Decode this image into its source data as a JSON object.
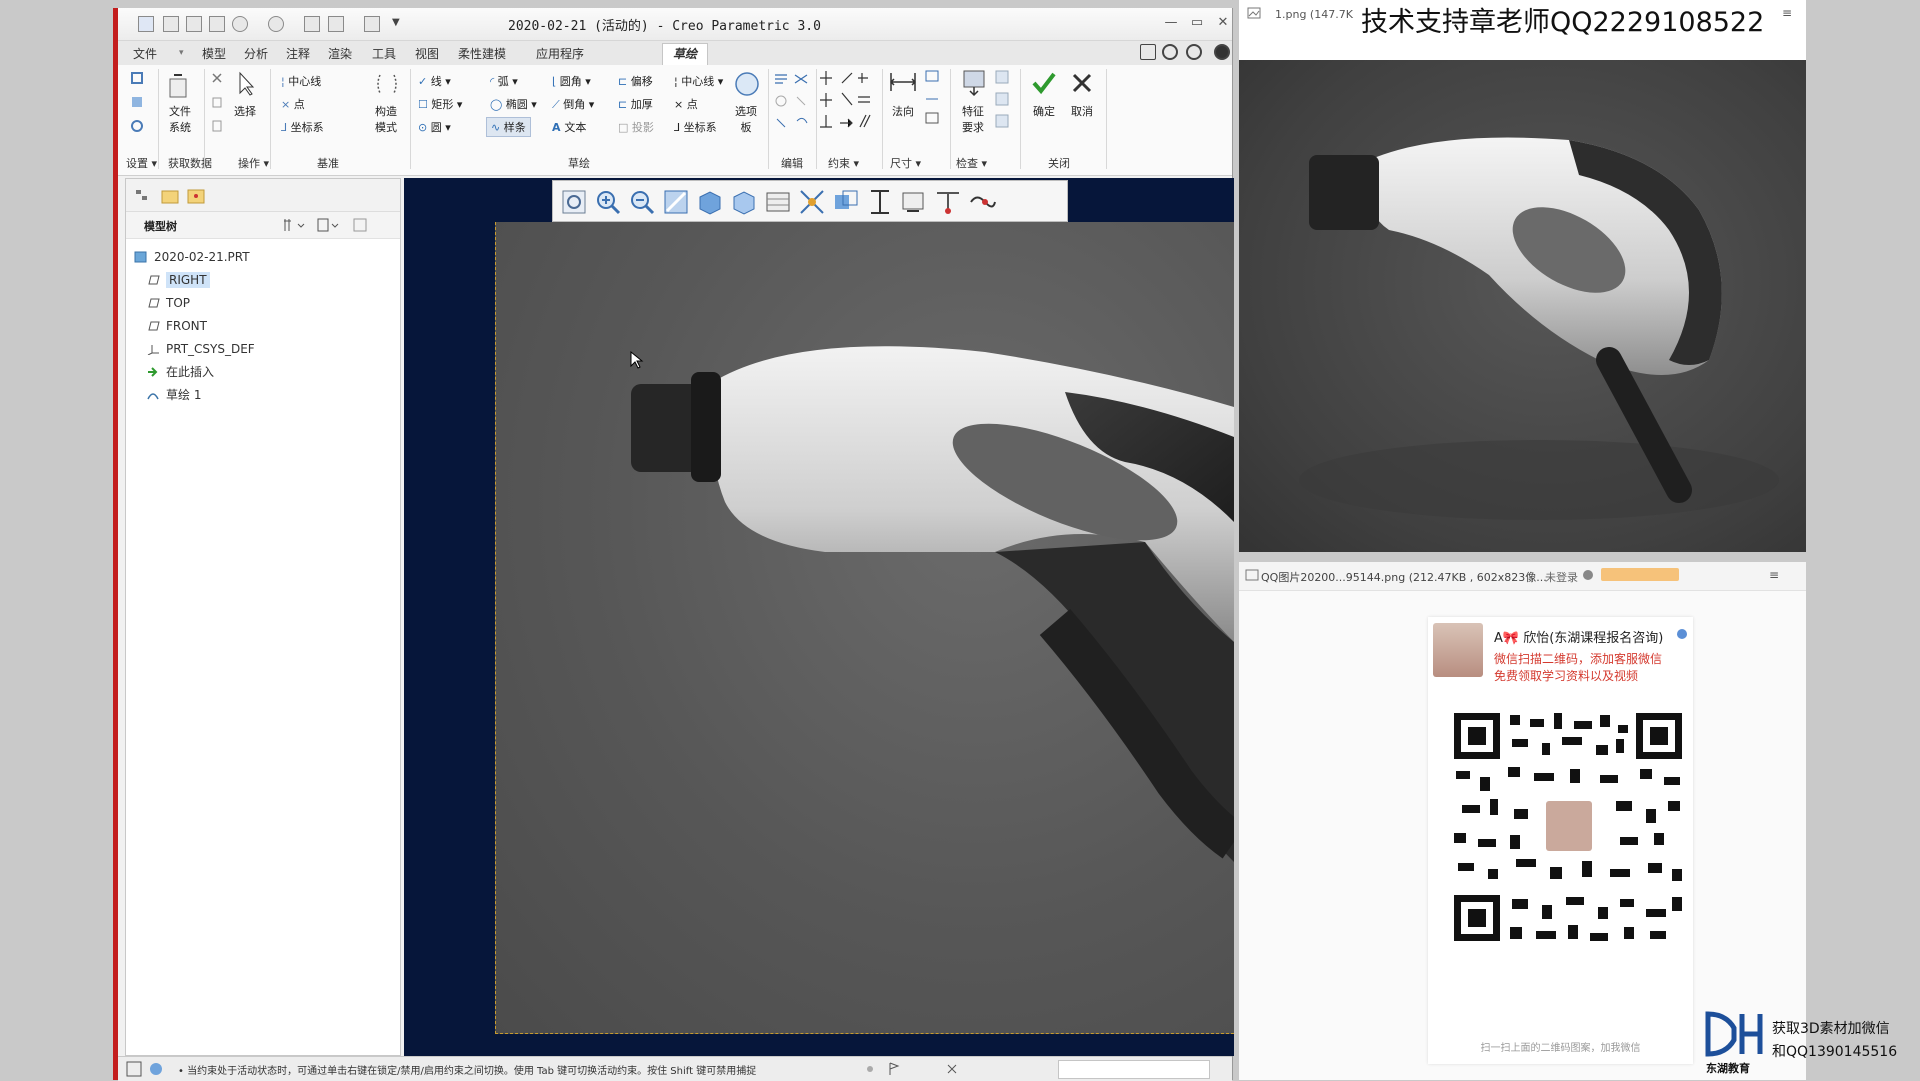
{
  "window": {
    "title": "2020-02-21 (活动的) - Creo Parametric 3.0"
  },
  "menu": {
    "tabs": [
      "文件",
      "模型",
      "分析",
      "注释",
      "渲染",
      "工具",
      "视图",
      "柔性建模",
      "应用程序",
      "草绘"
    ]
  },
  "ribbon": {
    "setup_label": "设置",
    "get_data_label": "获取数据",
    "operations_label": "操作",
    "datum_label": "基准",
    "sketch_label": "草绘",
    "edit_label": "编辑",
    "constrain_label": "约束",
    "dimension_label": "尺寸",
    "inspect_label": "检查",
    "close_label": "关闭",
    "file_system_label": "文件\n系统",
    "select_label": "选择",
    "centerline_label": "中心线",
    "point_label": "点",
    "coordsys_label": "坐标系",
    "construct_mode_label": "构造\n模式",
    "line_label": "线",
    "arc_label": "弧",
    "fillet_label": "圆角",
    "offset_label": "偏移",
    "centerline2_label": "中心线",
    "rectangle_label": "矩形",
    "ellipse_label": "椭圆",
    "chamfer_label": "倒角",
    "thicken_label": "加厚",
    "point2_label": "点",
    "circle_label": "圆",
    "spline_label": "样条",
    "text_label": "文本",
    "project_label": "投影",
    "coordsys2_label": "坐标系",
    "palette_label": "选项\n板",
    "normal_label": "法向",
    "feature_req_label": "特征\n要求",
    "ok_label": "确定",
    "cancel_label": "取消"
  },
  "tree": {
    "header": "模型树",
    "items": [
      {
        "label": "2020-02-21.PRT",
        "icon": "part-icon"
      },
      {
        "label": "RIGHT",
        "icon": "datum-plane-icon"
      },
      {
        "label": "TOP",
        "icon": "datum-plane-icon"
      },
      {
        "label": "FRONT",
        "icon": "datum-plane-icon"
      },
      {
        "label": "PRT_CSYS_DEF",
        "icon": "csys-icon"
      },
      {
        "label": "在此插入",
        "icon": "insert-arrow-icon"
      },
      {
        "label": "草绘 1",
        "icon": "sketch-icon"
      }
    ]
  },
  "status": {
    "message": "• 当约束处于活动状态时，可通过单击右键在锁定/禁用/启用约束之间切换。使用 Tab 键可切换活动约束。按住 Shift 键可禁用捕捉"
  },
  "viewer1": {
    "file_label": "1.png (147.7K",
    "watermark": "技术支持章老师QQ2229108522"
  },
  "viewer2": {
    "file_label": "QQ图片20200...95144.png (212.47KB , 602x823像...",
    "login_label": "未登录",
    "card_name": "A🎀 欣怡(东湖课程报名咨询)",
    "card_line1": "微信扫描二维码，添加客服微信",
    "card_line2": "免费领取学习资料以及视频",
    "card_footer": "扫一扫上面的二维码图案，加我微信"
  },
  "promo": {
    "logo_text": "东湖教育",
    "line1": "获取3D素材加微信",
    "line2": "和QQ1390145516"
  },
  "colors": {
    "accent_red": "#c31d1d",
    "confirm_green": "#2e9a2e",
    "graphics_bg": "#06163a"
  }
}
